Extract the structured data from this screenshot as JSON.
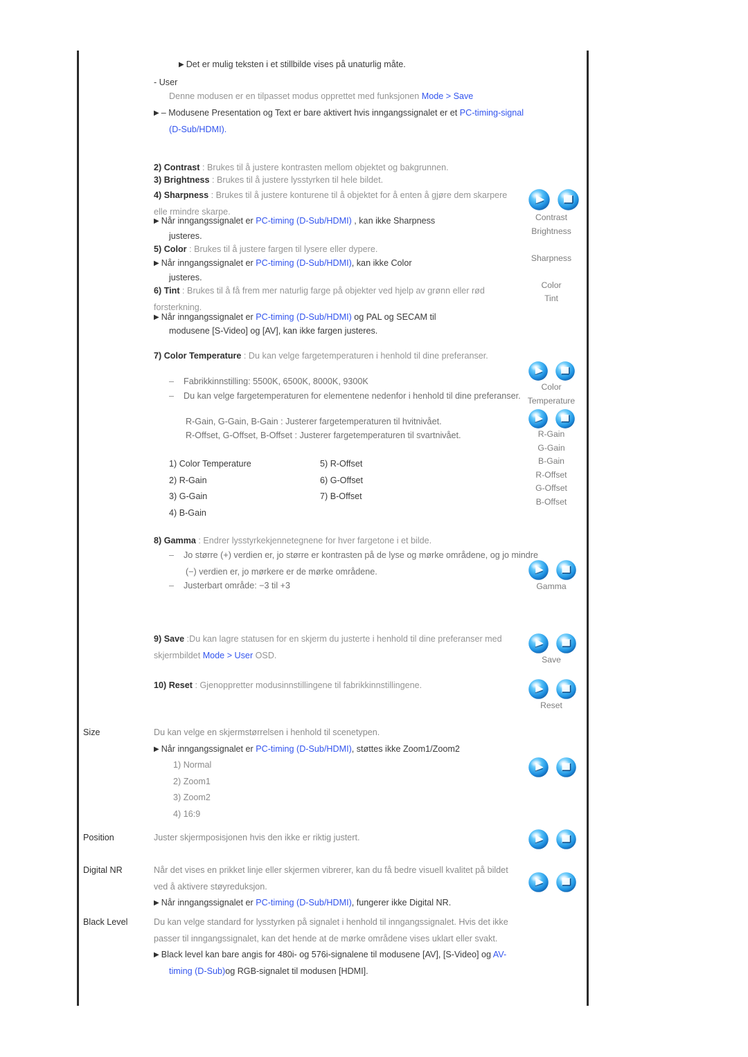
{
  "document": {
    "language": "Norwegian",
    "section_title": "Picture menu descriptions"
  },
  "colors": {
    "link": "#3355ee",
    "body_text": "#8a8a8a",
    "label_text": "#2f2f2f",
    "frame_rule": "#2b2b2b",
    "icon_blue": "#2ba6f5",
    "background": "#ffffff"
  },
  "body": {
    "note_stillbilde": "Det er mulig teksten i et stillbilde vises på unaturlig måte.",
    "user_dash": "- User",
    "user_desc_pre": "Denne modusen er en tilpasset modus opprettet med funksjonen ",
    "user_desc_link": "Mode > Save",
    "modusene_pre": "– Modusene Presentation og Text er bare aktivert hvis inngangssignalet er et ",
    "modusene_link": "PC-timing-signal (D-Sub/HDMI)",
    "modusene_post": ".",
    "item2_num": "2) ",
    "item2_label": "Contrast",
    "item2_desc": " : Brukes til å justere kontrasten mellom objektet og bakgrunnen.",
    "item3_num": "3) ",
    "item3_label": "Brightness",
    "item3_desc": " : Brukes til å justere lysstyrken til hele bildet.",
    "item4_num": "4) ",
    "item4_label": "Sharpness",
    "item4_desc": " : Brukes til å justere konturene til å objektet for å enten å gjøre dem skarpere elle rmindre skarpe.",
    "item4_note_pre": "Når inngangssignalet er ",
    "item4_note_link": "PC-timing (D-Sub/HDMI)",
    "item4_note_post": " , kan ikke Sharpness",
    "item4_note_cont": "justeres.",
    "item5_num": "5) ",
    "item5_label": "Color",
    "item5_desc": " : Brukes til å justere fargen til lysere eller dypere.",
    "item5_note_pre": "Når inngangssignalet er ",
    "item5_note_link": "PC-timing (D-Sub/HDMI)",
    "item5_note_post": ", kan ikke Color",
    "item5_note_cont": "justeres.",
    "item6_num": "6) ",
    "item6_label": "Tint",
    "item6_desc": " : Brukes til å få frem mer naturlig farge på objekter ved hjelp av grønn eller rød forsterkning.",
    "item6_note_pre": "Når inngangssignalet er ",
    "item6_note_link": "PC-timing (D-Sub/HDMI)",
    "item6_note_post": " og PAL og SECAM til",
    "item6_note_cont": "modusene [S-Video] og [AV], kan ikke fargen justeres.",
    "item7_num": "7) ",
    "item7_label": "Color Temperature",
    "item7_desc": " : Du kan velge fargetemperaturen i henhold til dine preferanser.",
    "item7_b1": "Fabrikkinnstilling: 5500K, 6500K, 8000K, 9300K",
    "item7_b2": "Du kan velge fargetemperaturen for elementene nedenfor i henhold til dine preferanser.",
    "item7_b3": "R-Gain, G-Gain, B-Gain : Justerer fargetemperaturen til hvitnivået.",
    "item7_b4": "R-Offset, G-Offset, B-Offset : Justerer fargetemperaturen til svartnivået.",
    "ct_list_left": [
      "1) Color Temperature",
      "2) R-Gain",
      "3) G-Gain",
      "4) B-Gain"
    ],
    "ct_list_right": [
      "5) R-Offset",
      "6) G-Offset",
      "7) B-Offset"
    ],
    "item8_num": "8) ",
    "item8_label": "Gamma",
    "item8_desc": " : Endrer lysstyrkekjennetegnene for hver fargetone i et bilde.",
    "item8_b1": "Jo større (+) verdien er, jo større er kontrasten på de lyse og mørke områdene, og jo mindre (−) verdien er, jo mørkere er de mørke områdene.",
    "item8_b2": "Justerbart område: −3 til +3",
    "item9_num": "9) ",
    "item9_label": "Save",
    "item9_desc": " :Du kan lagre statusen for en skjerm du justerte i henhold til dine preferanser med skjermbildet ",
    "item9_link": "Mode > User",
    "item9_post": " OSD.",
    "item10_num": "10) ",
    "item10_label": "Reset",
    "item10_desc": " : Gjenoppretter modusinnstillingene til fabrikkinnstillingene."
  },
  "definitions": [
    {
      "term": "Size",
      "desc": "Du kan velge en skjermstørrelsen i henhold til scenetypen.",
      "note_pre": "Når inngangssignalet er ",
      "note_link": "PC-timing (D-Sub/HDMI)",
      "note_post": ", støttes ikke Zoom1/Zoom2",
      "options": [
        "1) Normal",
        "2) Zoom1",
        "3) Zoom2",
        "4) 16:9"
      ]
    },
    {
      "term": "Position",
      "desc": "Juster skjermposisjonen hvis den ikke er riktig justert."
    },
    {
      "term": "Digital NR",
      "desc": "Når det vises en prikket linje eller skjermen vibrerer, kan du få bedre visuell kvalitet på bildet ved å aktivere støyreduksjon.",
      "note_pre": "Når inngangssignalet er ",
      "note_link": "PC-timing (D-Sub/HDMI)",
      "note_post": ", fungerer ikke Digital NR."
    },
    {
      "term": "Black Level",
      "desc": "Du kan velge standard for lysstyrken på signalet i henhold til inngangssignalet. Hvis det ikke passer til inngangssignalet, kan det hende at de mørke områdene vises uklart eller svakt.",
      "note_pre": "Black level kan bare angis for 480i- og 576i-signalene til modusene [AV], [S-Video] og ",
      "note_link": "AV-timing (D-Sub)",
      "note_post": "og RGB-signalet til modusen [HDMI]."
    }
  ],
  "icon_groups": [
    {
      "id": "group-contrast",
      "labels": [
        "Contrast",
        "Brightness",
        "",
        "Sharpness",
        "",
        "Color",
        "Tint"
      ]
    },
    {
      "id": "group-colortemp",
      "labels": [
        "Color",
        "Temperature"
      ]
    },
    {
      "id": "group-gains",
      "labels": [
        "R-Gain",
        "G-Gain",
        "B-Gain",
        "R-Offset",
        "G-Offset",
        "B-Offset"
      ]
    },
    {
      "id": "group-gamma",
      "labels": [
        "Gamma"
      ]
    },
    {
      "id": "group-save",
      "labels": [
        "Save"
      ]
    },
    {
      "id": "group-reset",
      "labels": [
        "Reset"
      ]
    },
    {
      "id": "group-size",
      "labels": []
    },
    {
      "id": "group-position",
      "labels": []
    },
    {
      "id": "group-digitalnr",
      "labels": []
    }
  ],
  "icons": {
    "left": "play-button-icon",
    "right": "enter-return-icon"
  }
}
